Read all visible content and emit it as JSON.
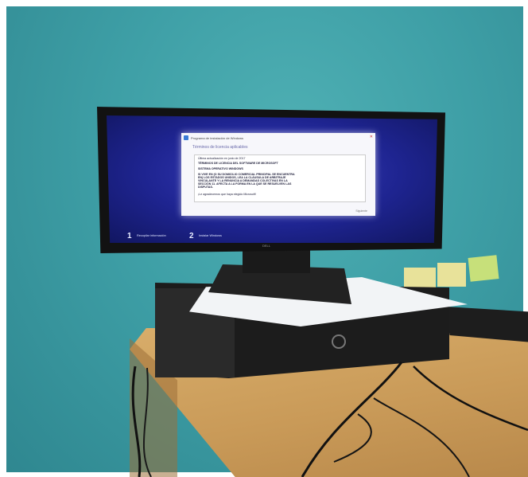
{
  "dialog": {
    "title": "Programa de instalación de Windows",
    "heading": "Términos de licencia aplicables",
    "lines": [
      "Última actualización en junio de 2017",
      "TÉRMINOS DE LICENCIA DEL SOFTWARE DE MICROSOFT",
      "SISTEMA OPERATIVO WINDOWS",
      "SI VIVE EN (O SU DOMICILIO COMERCIAL PRINCIPAL SE ENCUENTRA",
      "EN) LOS ESTADOS UNIDOS, LEA LA CLÁUSULA DE ARBITRAJE",
      "VINCULANTE Y LA RENUNCIA A DEMANDAS COLECTIVAS EN LA",
      "SECCIÓN 11. AFECTA A LA FORMA EN LA QUE SE RESUELVEN LAS",
      "DISPUTAS.",
      "¡Le agradecemos que haya elegido Microsoft!"
    ],
    "next_label": "Siguiente"
  },
  "setup_steps": [
    {
      "number": "1",
      "label": "Recopilar información"
    },
    {
      "number": "2",
      "label": "Instalar Windows"
    }
  ],
  "monitor_brand": "DELL",
  "colors": {
    "wall": "#3e9fa6",
    "screen": "#1e2490",
    "desk": "#c99a58"
  }
}
